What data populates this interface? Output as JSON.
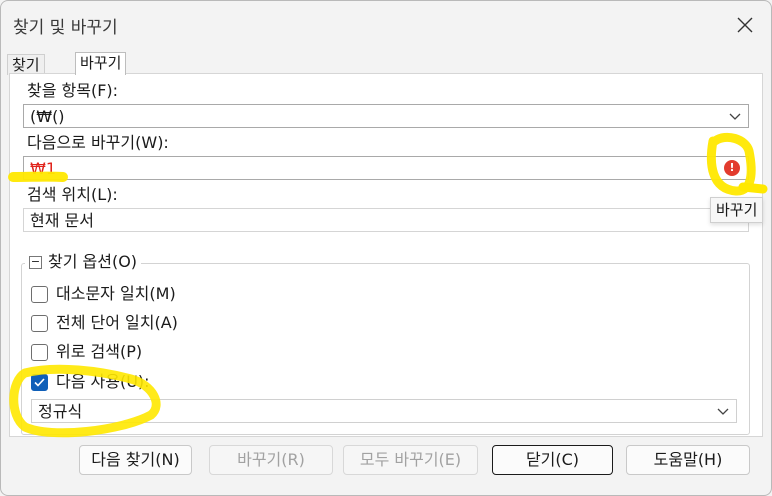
{
  "window": {
    "title": "찾기 및 바꾸기"
  },
  "tabs": [
    {
      "label": "찾기",
      "active": false
    },
    {
      "label": "바꾸기",
      "active": true
    }
  ],
  "find": {
    "label": "찾을 항목(F):",
    "value": "(₩()"
  },
  "replace": {
    "label": "다음으로 바꾸기(W):",
    "value": "₩1",
    "value_color": "#e0241c"
  },
  "tooltip": "바꾸기",
  "scope": {
    "label": "검색 위치(L):",
    "value": "현재 문서"
  },
  "options": {
    "title": "찾기  옵션(O)",
    "collapse_glyph": "−",
    "items": [
      {
        "label": "대소문자 일치(M)",
        "checked": false
      },
      {
        "label": "전체 단어 일치(A)",
        "checked": false
      },
      {
        "label": "위로 검색(P)",
        "checked": false
      },
      {
        "label": "다음 사용(U):",
        "checked": true
      }
    ],
    "mode": "정규식"
  },
  "buttons": {
    "find_next": "다음 찾기(N)",
    "replace": "바꾸기(R)",
    "replace_all": "모두 바꾸기(E)",
    "close": "닫기(C)",
    "help": "도움말(H)"
  },
  "colors": {
    "highlight": "#ffe800",
    "checkbox_accent": "#0f5fb8",
    "error": "#e23b2e"
  },
  "icons": {
    "close": "close-icon",
    "dropdown": "chevron-down-icon",
    "error": "error-icon",
    "check": "check-icon"
  }
}
